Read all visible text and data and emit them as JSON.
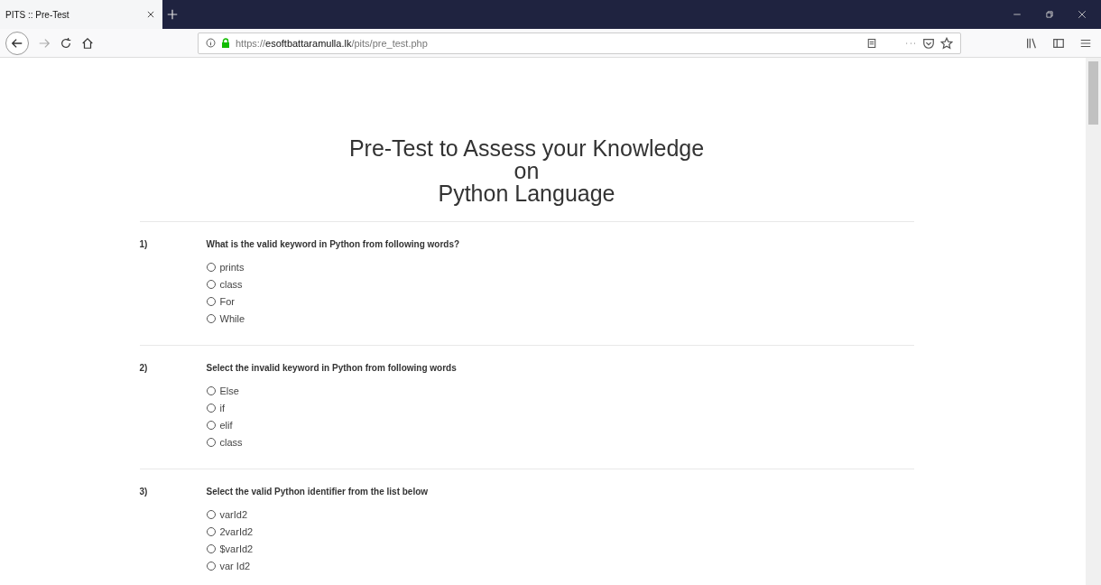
{
  "browser": {
    "tab_title": "PITS :: Pre-Test",
    "url": "https://**esoftbattaramulla.lk**/pits/pre_test.php"
  },
  "page": {
    "title_lines": [
      "Pre-Test to Assess your Knowledge",
      "on",
      "Python Language"
    ],
    "questions": [
      {
        "number": "1)",
        "text": "What is the valid keyword in Python from following words?",
        "options": [
          {
            "label": "prints",
            "selected": false
          },
          {
            "label": "class",
            "selected": false
          },
          {
            "label": "For",
            "selected": false
          },
          {
            "label": "While",
            "selected": false
          }
        ]
      },
      {
        "number": "2)",
        "text": "Select the invalid keyword in Python from following words",
        "options": [
          {
            "label": "Else",
            "selected": false
          },
          {
            "label": "if",
            "selected": false
          },
          {
            "label": "elif",
            "selected": false
          },
          {
            "label": "class",
            "selected": false
          }
        ]
      },
      {
        "number": "3)",
        "text": "Select the valid Python identifier from the list below",
        "options": [
          {
            "label": "varId2",
            "selected": false
          },
          {
            "label": "2varId2",
            "selected": false
          },
          {
            "label": "$varId2",
            "selected": false
          },
          {
            "label": "var Id2",
            "selected": false
          }
        ]
      }
    ]
  }
}
